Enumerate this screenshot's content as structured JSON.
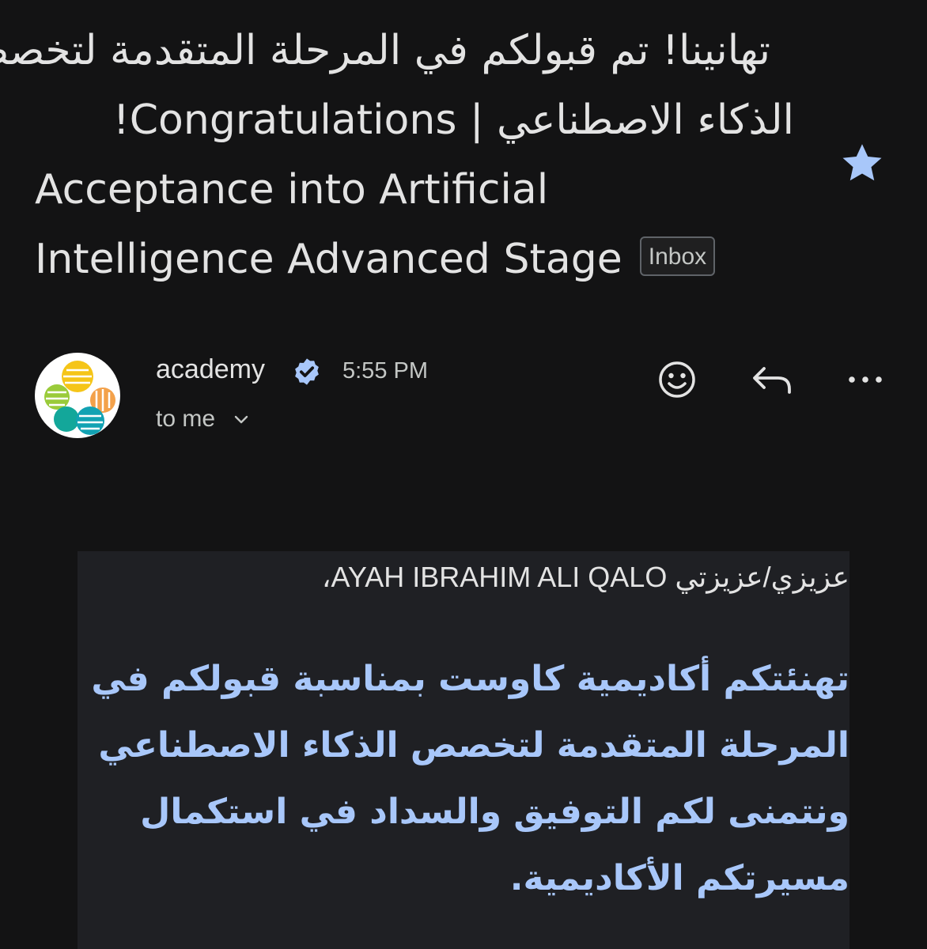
{
  "subject": {
    "line1": "تهانينا! تم قبولكم في المرحلة المتقدمة لتخصص",
    "line2": "الذكاء الاصطناعي | Congratulations!",
    "line3": "Acceptance into Artificial",
    "line4": "Intelligence Advanced Stage",
    "label_chip": "Inbox"
  },
  "sender": {
    "name": "academy",
    "time": "5:55 PM",
    "recipient": "to me"
  },
  "icons": {
    "star": "star-icon",
    "verified": "verified-badge-icon",
    "emoji": "emoji-reaction-icon",
    "reply": "reply-icon",
    "more": "more-options-icon",
    "chevron": "chevron-down-icon"
  },
  "body": {
    "greeting": "عزيزي/عزيزتي AYAH IBRAHIM ALI QALO،",
    "message_lines": [
      "تهنئتكم أكاديمية كاوست بمناسبة قبولكم في",
      "المرحلة المتقدمة لتخصص الذكاء الاصطناعي",
      "ونتمنى لكم التوفيق والسداد في استكمال",
      "مسيرتكم الأكاديمية."
    ]
  },
  "colors": {
    "background": "#131314",
    "text": "#e3e3e3",
    "accent_blue": "#a8c7fa",
    "body_card": "#1f2024"
  }
}
